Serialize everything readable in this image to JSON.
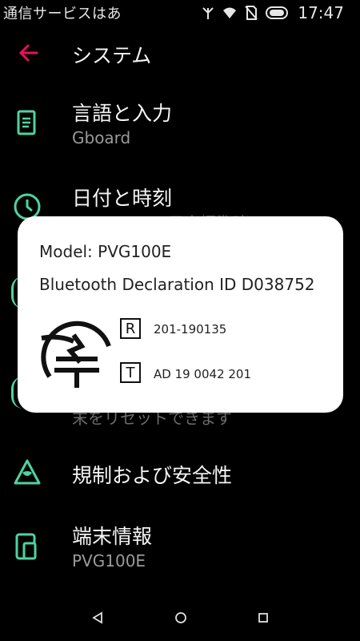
{
  "status_bar": {
    "notification_text": "通信サービスはあ",
    "time": "17:47"
  },
  "toolbar": {
    "title": "システム"
  },
  "items": [
    {
      "title": "言語と入力",
      "subtitle": "Gboard"
    },
    {
      "title": "日付と時刻",
      "subtitle": "日本標準時"
    },
    {
      "title": "規制および安全性",
      "subtitle": ""
    },
    {
      "title": "端末情報",
      "subtitle": "PVG100E"
    }
  ],
  "hidden_text": {
    "reset_subtitle_fragment": "末をリセットできます"
  },
  "dialog": {
    "model": "Model: PVG100E",
    "bluetooth": "Bluetooth Declaration ID D038752",
    "r_label": "R",
    "r_number": "201-190135",
    "t_label": "T",
    "t_number": "AD 19 0042 201"
  },
  "colors": {
    "accent": "#4ed3a0",
    "back_arrow": "#e8105a",
    "background": "#000000",
    "dialog": "#ffffff"
  }
}
